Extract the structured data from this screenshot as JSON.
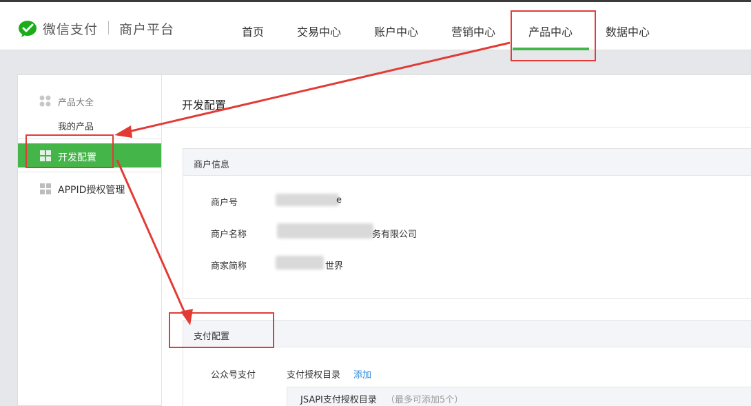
{
  "header": {
    "brand": "微信支付",
    "platform": "商户平台",
    "nav": [
      "首页",
      "交易中心",
      "账户中心",
      "营销中心",
      "产品中心",
      "数据中心"
    ],
    "active_nav": "产品中心",
    "accent_color": "#44b549"
  },
  "sidebar": {
    "section_title": "产品大全",
    "my_products": "我的产品",
    "dev_config": "开发配置",
    "appid_mgmt": "APPID授权管理"
  },
  "main": {
    "page_title": "开发配置",
    "merchant_info": {
      "title": "商户信息",
      "fields": [
        {
          "label": "商户号",
          "value_visible": "e"
        },
        {
          "label": "商户名称",
          "value_visible": "务有限公司"
        },
        {
          "label": "商家简称",
          "value_visible": "世界"
        }
      ]
    },
    "payment_config": {
      "title": "支付配置",
      "jsapi_label": "公众号支付",
      "auth_dir_label": "支付授权目录",
      "add_link": "添加",
      "jsapi_dir_title": "JSAPI支付授权目录",
      "jsapi_dir_hint": "（最多可添加5个）"
    }
  },
  "annotations": {
    "highlight_color": "#e23b36"
  }
}
